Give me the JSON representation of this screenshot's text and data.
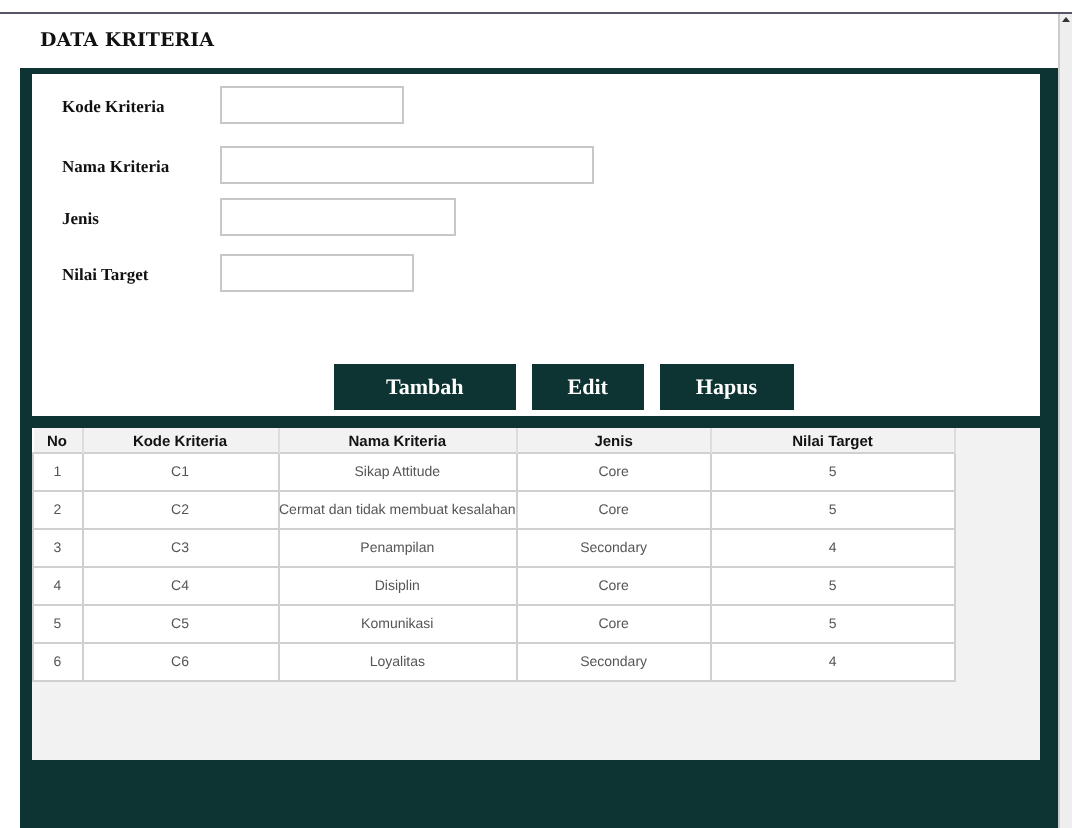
{
  "title": "DATA KRITERIA",
  "form": {
    "fields": [
      {
        "label": "Kode Kriteria"
      },
      {
        "label": "Nama Kriteria"
      },
      {
        "label": "Jenis"
      },
      {
        "label": "Nilai Target"
      }
    ],
    "buttons": [
      "Tambah",
      "Edit",
      "Hapus"
    ]
  },
  "table": {
    "columns": [
      "No",
      "Kode Kriteria",
      "Nama Kriteria",
      "Jenis",
      "Nilai Target"
    ],
    "rows": [
      [
        "1",
        "C1",
        "Sikap Attitude",
        "Core",
        "5"
      ],
      [
        "2",
        "C2",
        "Cermat dan tidak membuat kesalahan",
        "Core",
        "5"
      ],
      [
        "3",
        "C3",
        "Penampilan",
        "Secondary",
        "4"
      ],
      [
        "4",
        "C4",
        "Disiplin",
        "Core",
        "5"
      ],
      [
        "5",
        "C5",
        "Komunikasi",
        "Core",
        "5"
      ],
      [
        "6",
        "C6",
        "Loyalitas",
        "Secondary",
        "4"
      ]
    ]
  }
}
